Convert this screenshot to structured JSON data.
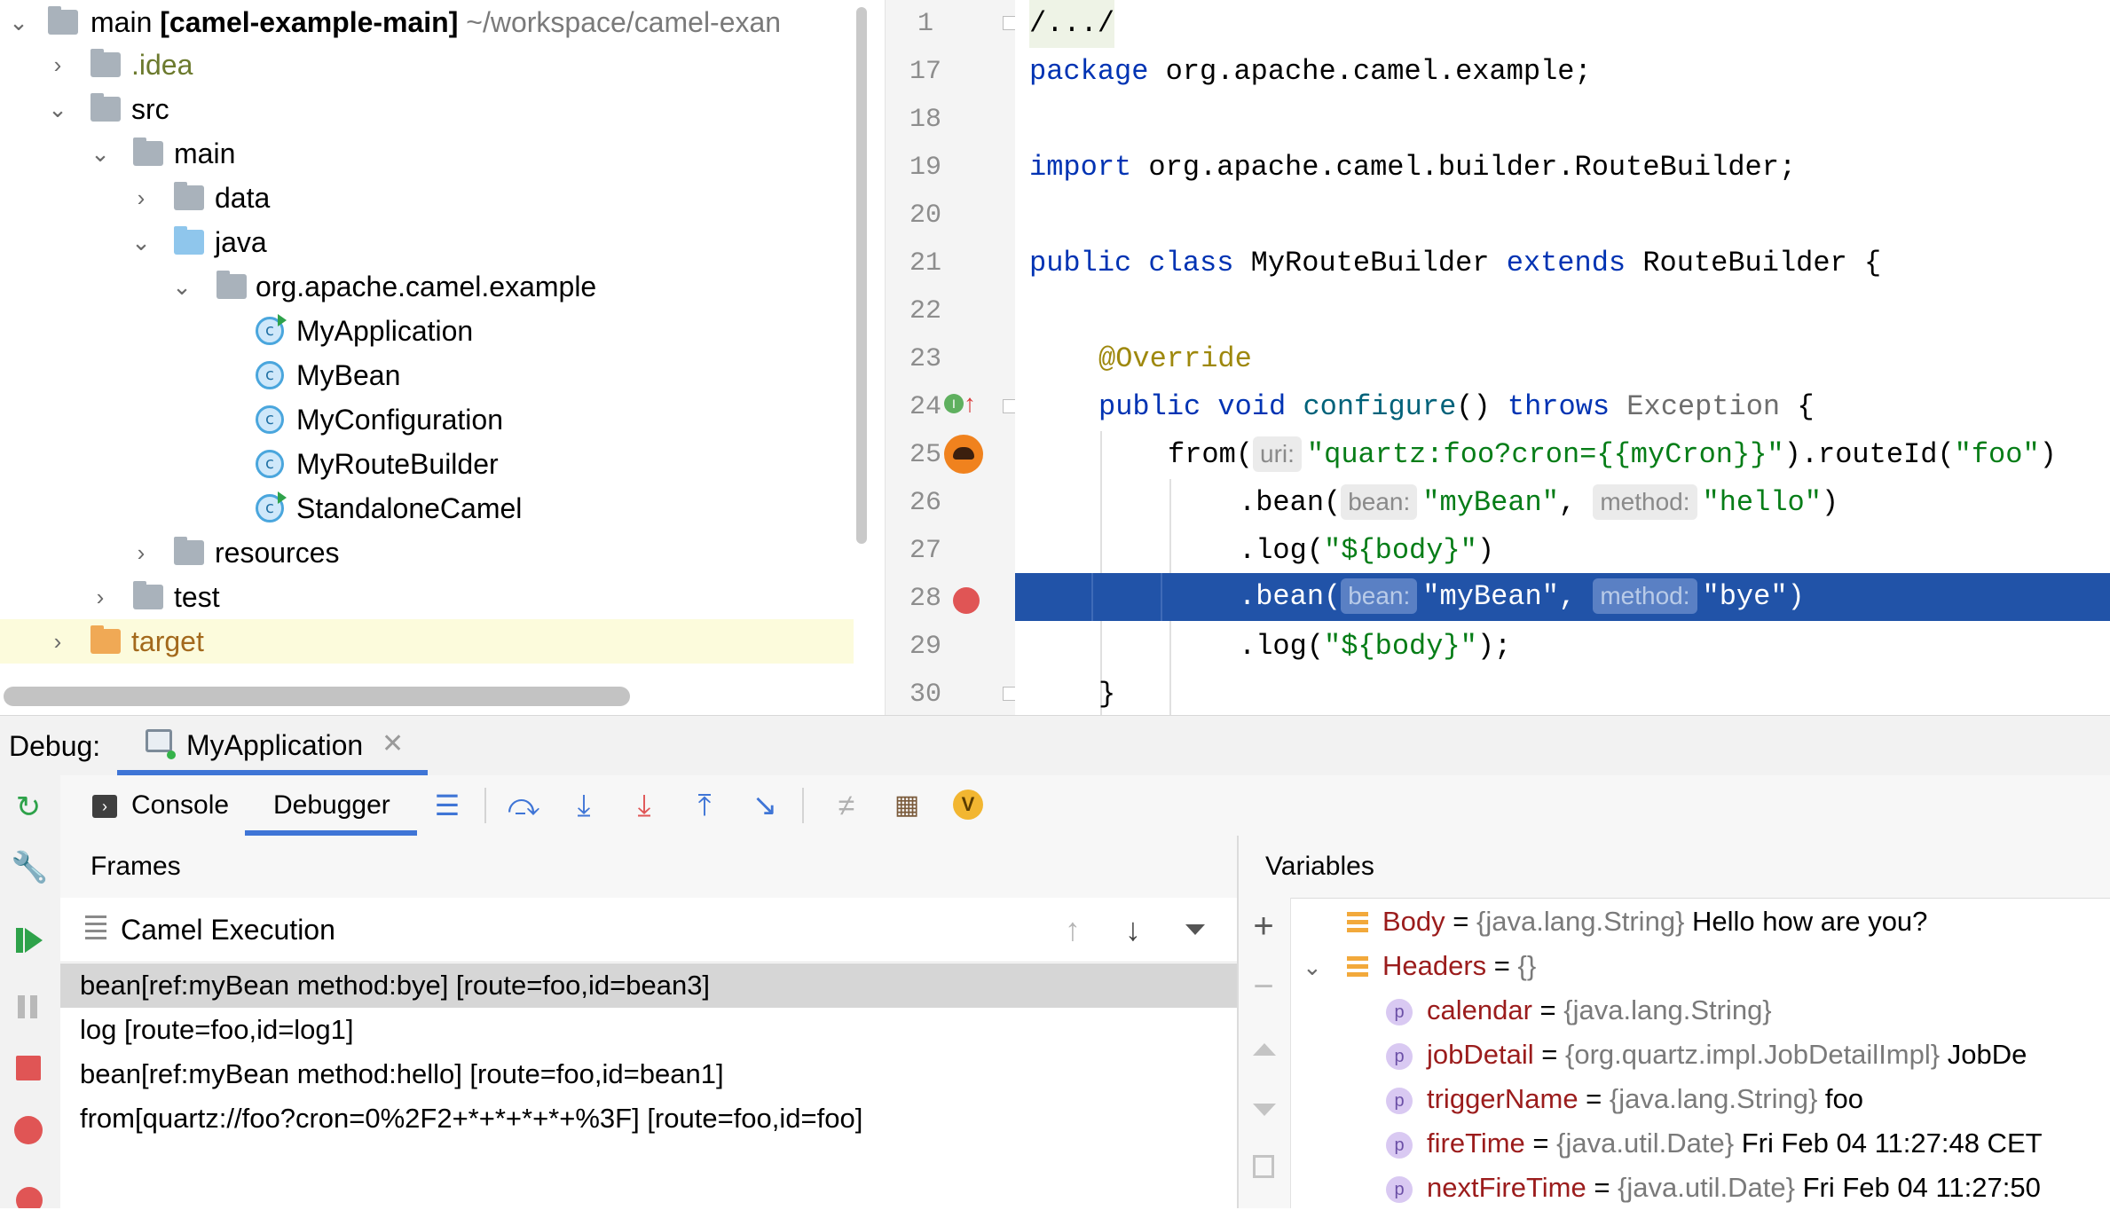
{
  "colors": {
    "accent": "#2153a8",
    "tab_underline": "#3f75d6",
    "breakpoint": "#e05555"
  },
  "project_tree": {
    "rows": [
      {
        "label": "main",
        "bold": "[camel-example-main]",
        "path": "~/workspace/camel-exan"
      },
      {
        "label": ".idea"
      },
      {
        "label": "src"
      },
      {
        "label": "main"
      },
      {
        "label": "data"
      },
      {
        "label": "java"
      },
      {
        "label": "org.apache.camel.example"
      },
      {
        "label": "MyApplication"
      },
      {
        "label": "MyBean"
      },
      {
        "label": "MyConfiguration"
      },
      {
        "label": "MyRouteBuilder"
      },
      {
        "label": "StandaloneCamel"
      },
      {
        "label": "resources"
      },
      {
        "label": "test"
      },
      {
        "label": "target"
      }
    ]
  },
  "editor": {
    "line_numbers": [
      "1",
      "17",
      "18",
      "19",
      "20",
      "21",
      "22",
      "23",
      "24",
      "25",
      "26",
      "27",
      "28",
      "29",
      "30"
    ],
    "line1": "/.../",
    "line17": {
      "kw": "package",
      "rest": " org.apache.camel.example;"
    },
    "line19": {
      "kw": "import",
      "rest": " org.apache.camel.builder.RouteBuilder;"
    },
    "line21": {
      "kw1": "public",
      "kw2": "class",
      "name": "MyRouteBuilder",
      "kw3": "extends",
      "rest": "RouteBuilder {"
    },
    "line23": "@Override",
    "line24": {
      "kw1": "public",
      "kw2": "void",
      "fn": "configure",
      "paren": "()",
      "kw3": "throws",
      "ty": "Exception",
      "rest": " {"
    },
    "line25": {
      "pre": "from(",
      "hint": "uri:",
      "str": "\"quartz:foo?cron={{myCron}}\"",
      "mid": ").routeId(",
      "str2": "\"foo\"",
      "post": ")"
    },
    "line26": {
      "pre": ".bean(",
      "hint1": "bean:",
      "str1": "\"myBean\"",
      "comma": ", ",
      "hint2": "method:",
      "str2": "\"hello\"",
      "post": ")"
    },
    "line27": {
      "pre": ".log(",
      "str": "\"${body}\"",
      "post": ")"
    },
    "line28": {
      "pre": ".bean(",
      "hint1": "bean:",
      "str1": "\"myBean\"",
      "comma": ", ",
      "hint2": "method:",
      "str2": "\"bye\"",
      "post": ")"
    },
    "line29": {
      "pre": ".log(",
      "str": "\"${body}\"",
      "post": ");"
    },
    "line30": "}"
  },
  "debug": {
    "label": "Debug:",
    "tab": "MyApplication",
    "toolbar": {
      "console": "Console",
      "debugger": "Debugger"
    },
    "frames": {
      "header": "Frames",
      "thread": "Camel Execution",
      "items": [
        "bean[ref:myBean method:bye] [route=foo,id=bean3]",
        "log [route=foo,id=log1]",
        "bean[ref:myBean method:hello] [route=foo,id=bean1]",
        "from[quartz://foo?cron=0%2F2+*+*+*+*+%3F] [route=foo,id=foo]"
      ]
    },
    "variables": {
      "header": "Variables",
      "body": {
        "name": "Body",
        "eq": " = ",
        "type": "{java.lang.String}",
        "value": " Hello how are you?"
      },
      "headers": {
        "name": "Headers",
        "eq": " = ",
        "value": "{}"
      },
      "items": [
        {
          "name": "calendar",
          "type": "{java.lang.String}",
          "value": ""
        },
        {
          "name": "jobDetail",
          "type": "{org.quartz.impl.JobDetailImpl}",
          "value": " JobDe"
        },
        {
          "name": "triggerName",
          "type": "{java.lang.String}",
          "value": " foo"
        },
        {
          "name": "fireTime",
          "type": "{java.util.Date}",
          "value": " Fri Feb 04 11:27:48 CET"
        },
        {
          "name": "nextFireTime",
          "type": "{java.util.Date}",
          "value": " Fri Feb 04 11:27:50"
        }
      ]
    }
  }
}
